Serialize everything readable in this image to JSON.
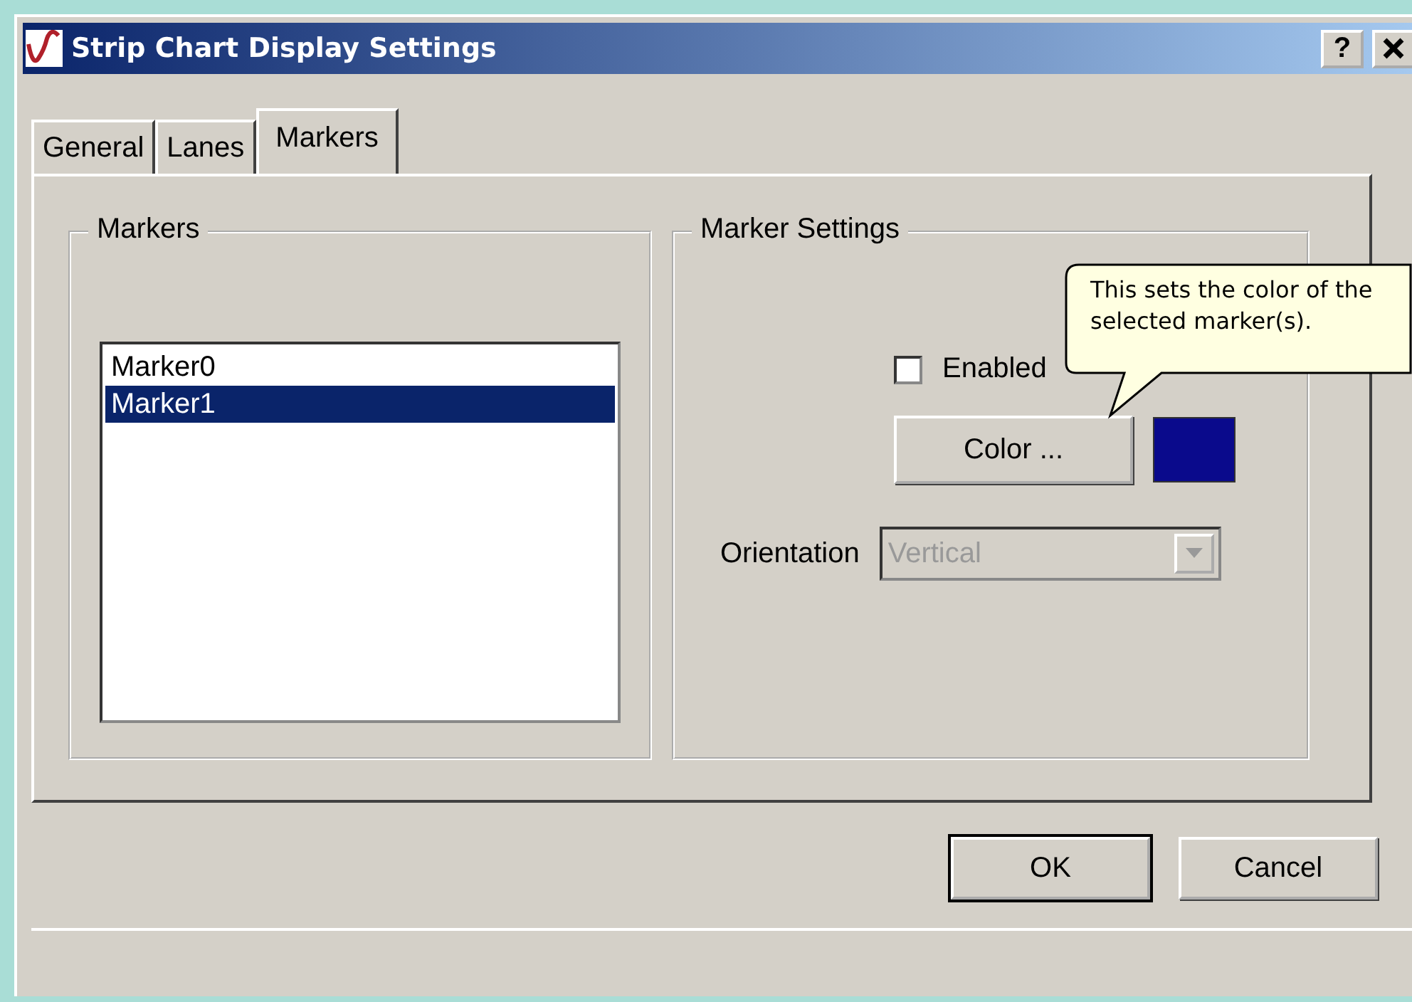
{
  "window": {
    "title": "Strip Chart Display Settings",
    "help_button": "?"
  },
  "tabs": [
    {
      "label": "General",
      "selected": false
    },
    {
      "label": "Lanes",
      "selected": false
    },
    {
      "label": "Markers",
      "selected": true
    }
  ],
  "markers_group": {
    "title": "Markers",
    "items": [
      {
        "label": "Marker0",
        "selected": false
      },
      {
        "label": "Marker1",
        "selected": true
      }
    ]
  },
  "marker_settings": {
    "title": "Marker Settings",
    "enabled": {
      "label": "Enabled",
      "checked": false
    },
    "color_button": "Color ...",
    "swatch": {
      "color": "#0a0a8c"
    },
    "orientation": {
      "label": "Orientation",
      "value": "Vertical",
      "disabled": true
    }
  },
  "tooltip": {
    "text": "This sets the color of the selected marker(s)."
  },
  "buttons": [
    {
      "label": "OK",
      "default": true
    },
    {
      "label": "Cancel",
      "default": false
    }
  ]
}
